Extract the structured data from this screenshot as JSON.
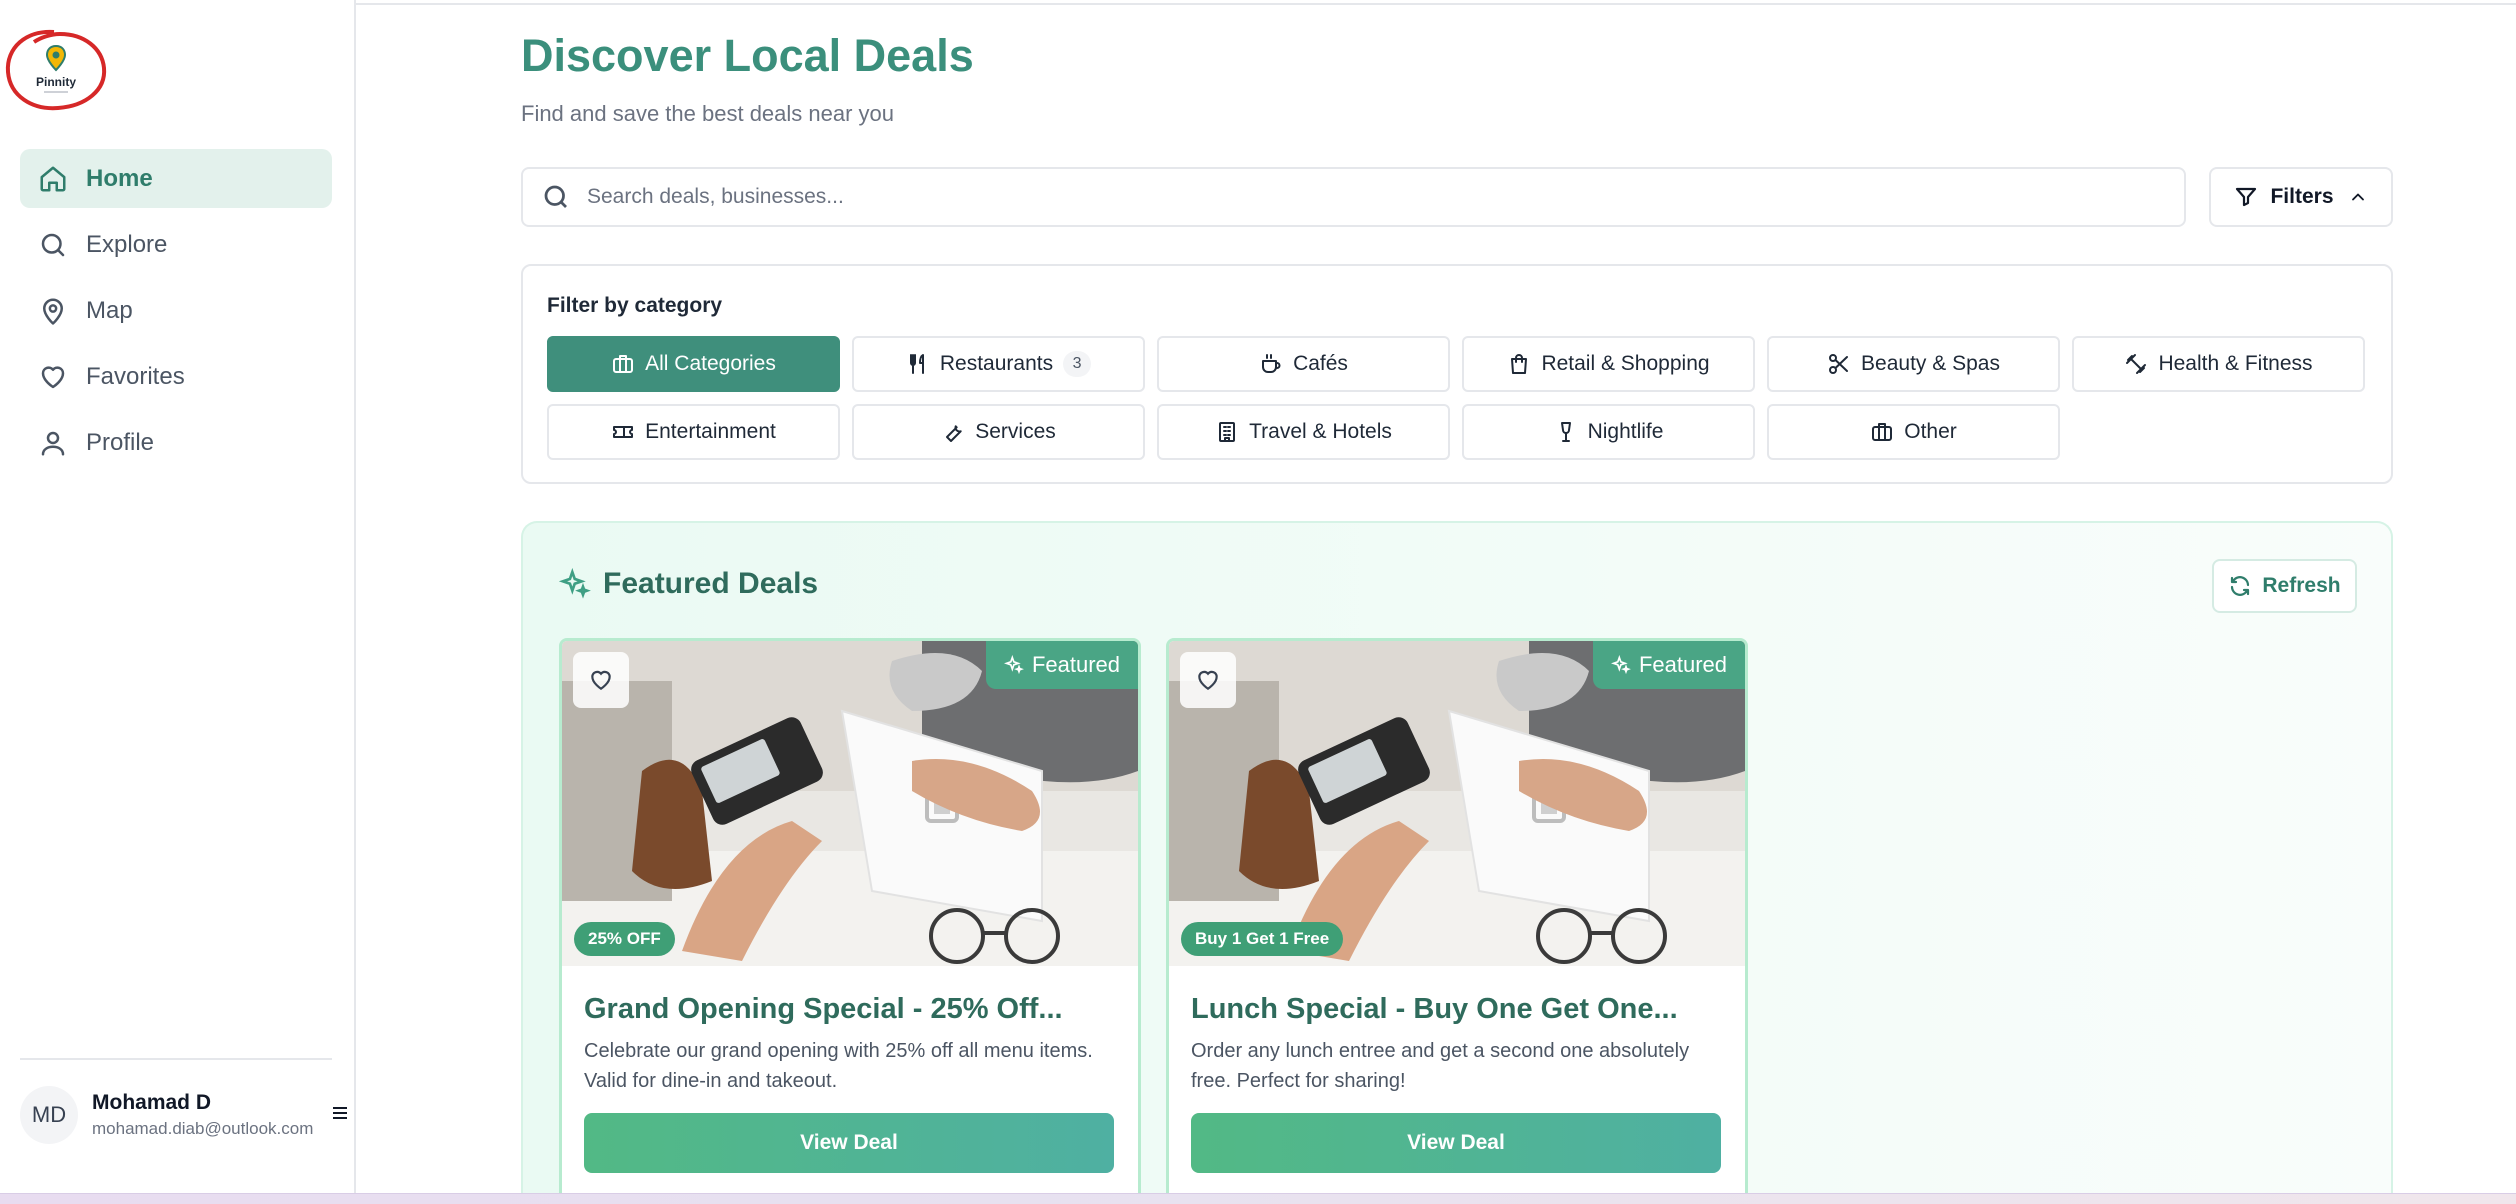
{
  "brand": {
    "name": "Pinnity",
    "accent": "#3b8f7c"
  },
  "sidebar": {
    "items": [
      {
        "label": "Home",
        "icon": "home-icon",
        "active": true
      },
      {
        "label": "Explore",
        "icon": "search-icon",
        "active": false
      },
      {
        "label": "Map",
        "icon": "map-pin-icon",
        "active": false
      },
      {
        "label": "Favorites",
        "icon": "heart-icon",
        "active": false
      },
      {
        "label": "Profile",
        "icon": "user-icon",
        "active": false
      }
    ],
    "user": {
      "initials": "MD",
      "name": "Mohamad D",
      "email": "mohamad.diab@outlook.com"
    }
  },
  "header": {
    "title": "Discover Local Deals",
    "subtitle": "Find and save the best deals near you"
  },
  "search": {
    "placeholder": "Search deals, businesses...",
    "value": ""
  },
  "filters": {
    "label": "Filters"
  },
  "categories": {
    "label": "Filter by category",
    "items": [
      {
        "label": "All Categories",
        "icon": "briefcase-icon",
        "active": true
      },
      {
        "label": "Restaurants",
        "icon": "utensils-icon",
        "count": "3"
      },
      {
        "label": "Cafés",
        "icon": "coffee-icon"
      },
      {
        "label": "Retail & Shopping",
        "icon": "shopping-bag-icon"
      },
      {
        "label": "Beauty & Spas",
        "icon": "scissors-icon"
      },
      {
        "label": "Health & Fitness",
        "icon": "dumbbell-icon"
      },
      {
        "label": "Entertainment",
        "icon": "ticket-icon"
      },
      {
        "label": "Services",
        "icon": "wrench-icon"
      },
      {
        "label": "Travel & Hotels",
        "icon": "building-icon"
      },
      {
        "label": "Nightlife",
        "icon": "wine-icon"
      },
      {
        "label": "Other",
        "icon": "briefcase-icon"
      }
    ]
  },
  "featured": {
    "title": "Featured Deals",
    "refresh_label": "Refresh",
    "deals": [
      {
        "badge": "Featured",
        "discount": "25% OFF",
        "title": "Grand Opening Special - 25% Off...",
        "description": "Celebrate our grand opening with 25% off all menu items. Valid for dine-in and takeout.",
        "button": "View Deal"
      },
      {
        "badge": "Featured",
        "discount": "Buy 1 Get 1 Free",
        "title": "Lunch Special - Buy One Get One...",
        "description": "Order any lunch entree and get a second one absolutely free. Perfect for sharing!",
        "button": "View Deal"
      }
    ]
  }
}
